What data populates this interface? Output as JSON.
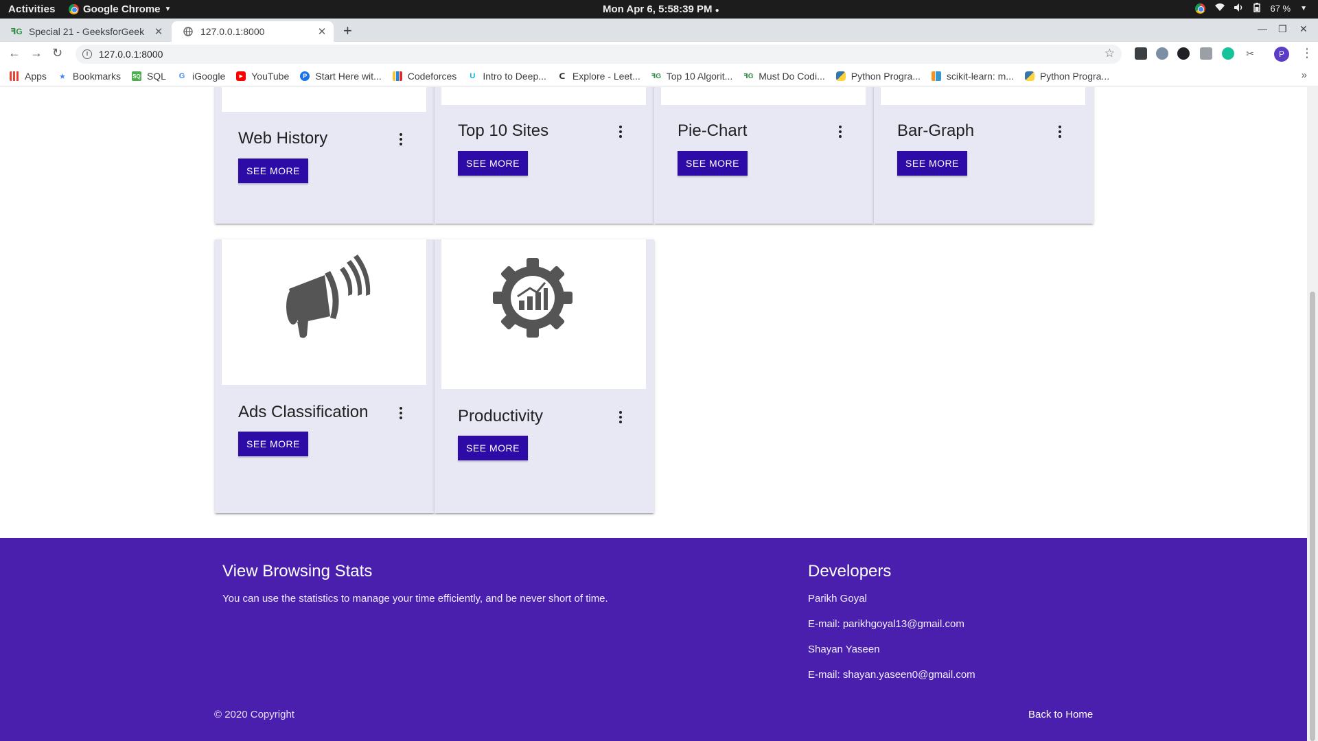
{
  "os_bar": {
    "activities": "Activities",
    "app_name": "Google Chrome",
    "clock": "Mon Apr  6,  5:58:39 PM",
    "battery": "67 %"
  },
  "browser": {
    "tabs": [
      {
        "title": "Special 21 - GeeksforGeek",
        "active": false
      },
      {
        "title": "127.0.0.1:8000",
        "active": true
      }
    ],
    "url": "127.0.0.1:8000",
    "profile_initial": "P",
    "bookmarks": [
      {
        "label": "Apps",
        "icon": "apps-grid-icon"
      },
      {
        "label": "Bookmarks",
        "icon": "star-icon"
      },
      {
        "label": "SQL",
        "icon": "sql-icon"
      },
      {
        "label": "iGoogle",
        "icon": "google-icon"
      },
      {
        "label": "YouTube",
        "icon": "youtube-icon"
      },
      {
        "label": "Start Here wit...",
        "icon": "p-icon"
      },
      {
        "label": "Codeforces",
        "icon": "codeforces-icon"
      },
      {
        "label": "Intro to Deep...",
        "icon": "udacity-icon"
      },
      {
        "label": "Explore - Leet...",
        "icon": "leetcode-icon"
      },
      {
        "label": "Top 10 Algorit...",
        "icon": "gfg-icon"
      },
      {
        "label": "Must Do Codi...",
        "icon": "gfg-icon"
      },
      {
        "label": "Python Progra...",
        "icon": "python-icon"
      },
      {
        "label": "scikit-learn: m...",
        "icon": "chart-icon"
      },
      {
        "label": "Python Progra...",
        "icon": "python-icon"
      }
    ]
  },
  "cards": [
    {
      "title": "Web History",
      "button": "SEE MORE"
    },
    {
      "title": "Top 10 Sites",
      "button": "SEE MORE"
    },
    {
      "title": "Pie-Chart",
      "button": "SEE MORE"
    },
    {
      "title": "Bar-Graph",
      "button": "SEE MORE"
    },
    {
      "title": "Ads Classification",
      "button": "SEE MORE",
      "image": "megaphone-icon"
    },
    {
      "title": "Productivity",
      "button": "SEE MORE",
      "image": "gear-chart-icon"
    }
  ],
  "footer": {
    "left_title": "View Browsing Stats",
    "left_text": "You can use the statistics to manage your time efficiently, and be never short of time.",
    "right_title": "Developers",
    "dev1_name": "Parikh Goyal",
    "dev1_email": "E-mail: parikhgoyal13@gmail.com",
    "dev2_name": "Shayan Yaseen",
    "dev2_email": "E-mail: shayan.yaseen0@gmail.com",
    "copyright": "© 2020 Copyright",
    "back_home": "Back to Home",
    "color": "#4a1fad"
  },
  "colors": {
    "button": "#2c0ba6",
    "card_bg": "#e8e8f5"
  }
}
